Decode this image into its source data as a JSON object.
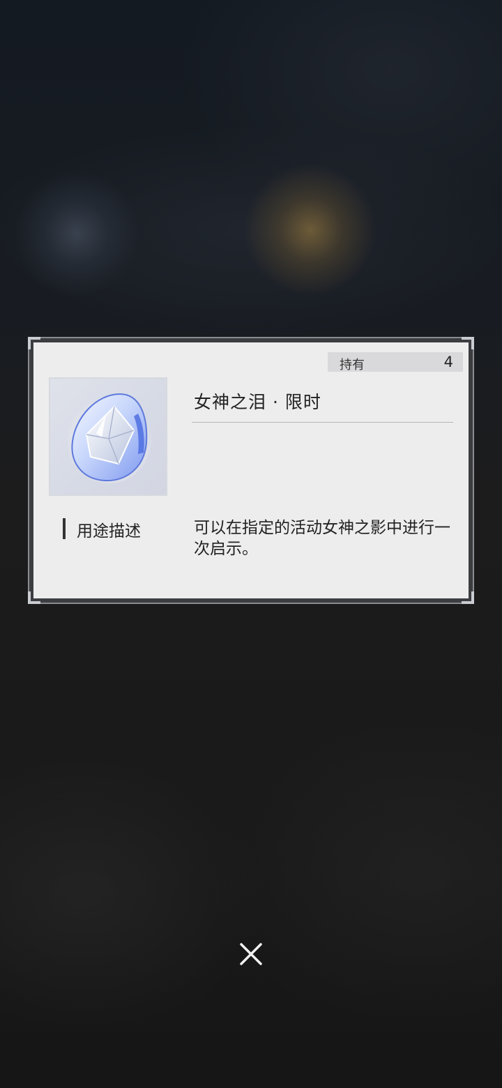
{
  "item_detail": {
    "owned_label": "持有",
    "owned_count": "4",
    "item_name": "女神之泪 · 限时",
    "usage_label": "用途描述",
    "usage_description": "可以在指定的活动女神之影中进行一次启示。",
    "item_icon": "crystal-teardrop-icon"
  },
  "controls": {
    "close_icon": "close-icon"
  },
  "colors": {
    "panel_background": "#ededee",
    "owned_bar": "#d9d9db",
    "text": "#222222",
    "backdrop": "#181818",
    "close_icon": "#f2f2f2"
  }
}
